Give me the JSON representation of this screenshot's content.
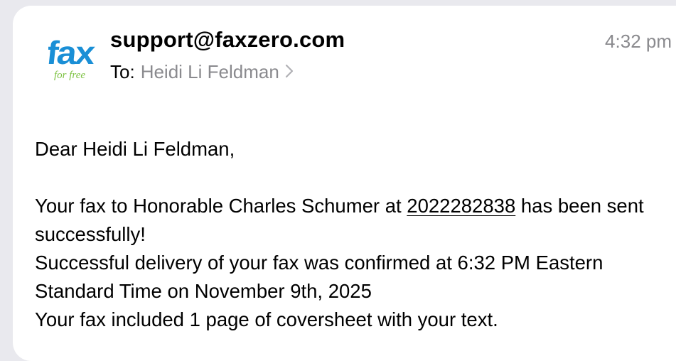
{
  "email": {
    "logo": {
      "main_text": "fax",
      "sub_text": "for free",
      "main_color": "#1a8fd6",
      "sub_color": "#7dc242",
      "icon": "faxzero-logo-icon"
    },
    "sender": "support@faxzero.com",
    "time": "4:32 pm",
    "to_label": "To:",
    "recipient": "Heidi Li Feldman",
    "recipient_chevron_icon": "chevron-right-icon",
    "greeting": "Dear Heidi Li Feldman,",
    "line1_prefix": "Your fax to Honorable Charles Schumer at ",
    "phone_number": "2022282838",
    "line1_suffix": " has been sent successfully!",
    "line2": "Successful delivery of your fax was confirmed at 6:32 PM Eastern Standard Time on November 9th, 2025",
    "line3": "Your fax included 1 page of coversheet with your text."
  }
}
